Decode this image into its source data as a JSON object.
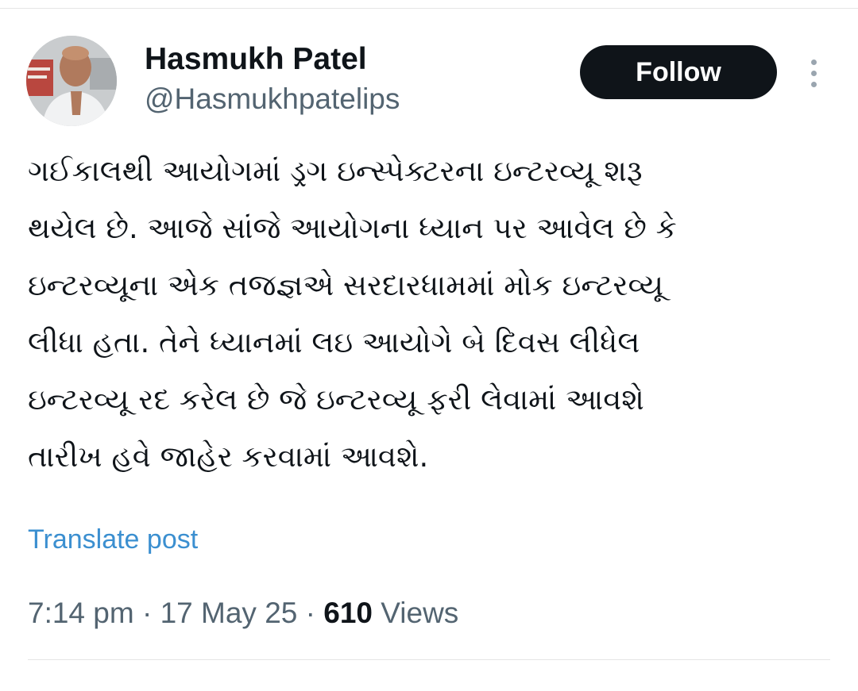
{
  "author": {
    "name": "Hasmukh Patel",
    "handle": "@Hasmukhpatelips"
  },
  "follow_label": "Follow",
  "more_icon": "more-vertical-icon",
  "tweet": {
    "lines": [
      "ગઈકાલથી આયોગમાં ડ્રગ ઇન્સ્પેક્ટરના ઇન્ટરવ્યૂ શરૂ",
      "થયેલ છે. આજે સાંજે આયોગના ધ્યાન પર આવેલ છે કે",
      "ઇન્ટરવ્યૂના એક તજજ્ઞએ સરદારધામમાં મોક ઇન્ટરવ્યૂ",
      "લીધા હતા. તેને ધ્યાનમાં લઇ આયોગે બે દિવસ લીધેલ",
      "ઇન્ટરવ્યૂ રદ કરેલ છે જે ઇન્ટરવ્યૂ ફરી લેવામાં આવશે",
      "તારીખ હવે જાહેર કરવામાં આવશે."
    ]
  },
  "translate_label": "Translate post",
  "meta": {
    "time": "7:14 pm",
    "separator": " · ",
    "date": "17 May 25",
    "views_count": "610",
    "views_label": " Views"
  },
  "colors": {
    "text": "#0f1419",
    "secondary": "#536471",
    "link": "#3b8fd0",
    "button_bg": "#0f1419",
    "button_text": "#ffffff"
  }
}
